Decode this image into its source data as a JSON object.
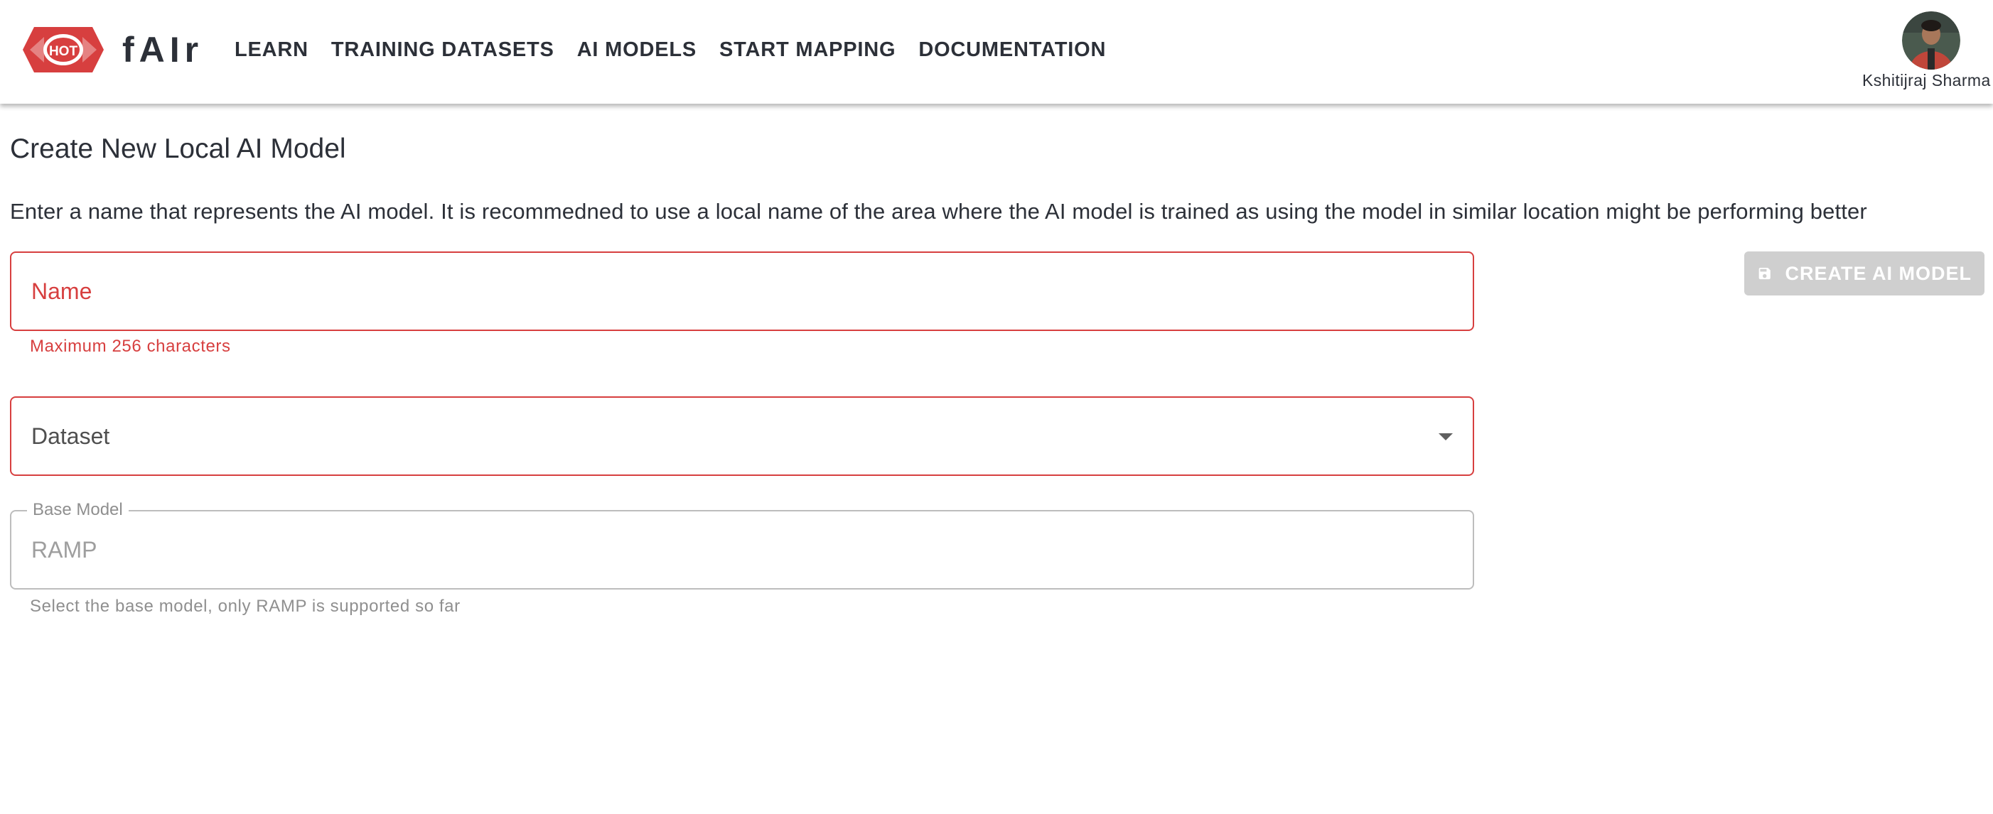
{
  "header": {
    "logo_text": "HOT",
    "brand": "fAIr",
    "nav": [
      {
        "label": "LEARN"
      },
      {
        "label": "TRAINING DATASETS"
      },
      {
        "label": "AI MODELS"
      },
      {
        "label": "START MAPPING"
      },
      {
        "label": "DOCUMENTATION"
      }
    ],
    "user": {
      "name": "Kshitijraj Sharma"
    }
  },
  "main": {
    "title": "Create New Local AI Model",
    "description": "Enter a name that represents the AI model. It is recommedned to use a local name of the area where the AI model is trained as using the model in similar location might be performing better",
    "name_field": {
      "placeholder": "Name",
      "value": "",
      "helper": "Maximum 256 characters"
    },
    "dataset_field": {
      "label": "Dataset",
      "value": ""
    },
    "base_model_field": {
      "legend": "Base Model",
      "value": "RAMP",
      "helper": "Select the base model, only RAMP is supported so far"
    },
    "create_button": {
      "label": "CREATE AI MODEL",
      "icon": "save-icon",
      "disabled": true
    }
  },
  "colors": {
    "brand_red": "#d73f3f",
    "text_dark": "#2c3038",
    "disabled_gray": "#cfcfcf"
  }
}
